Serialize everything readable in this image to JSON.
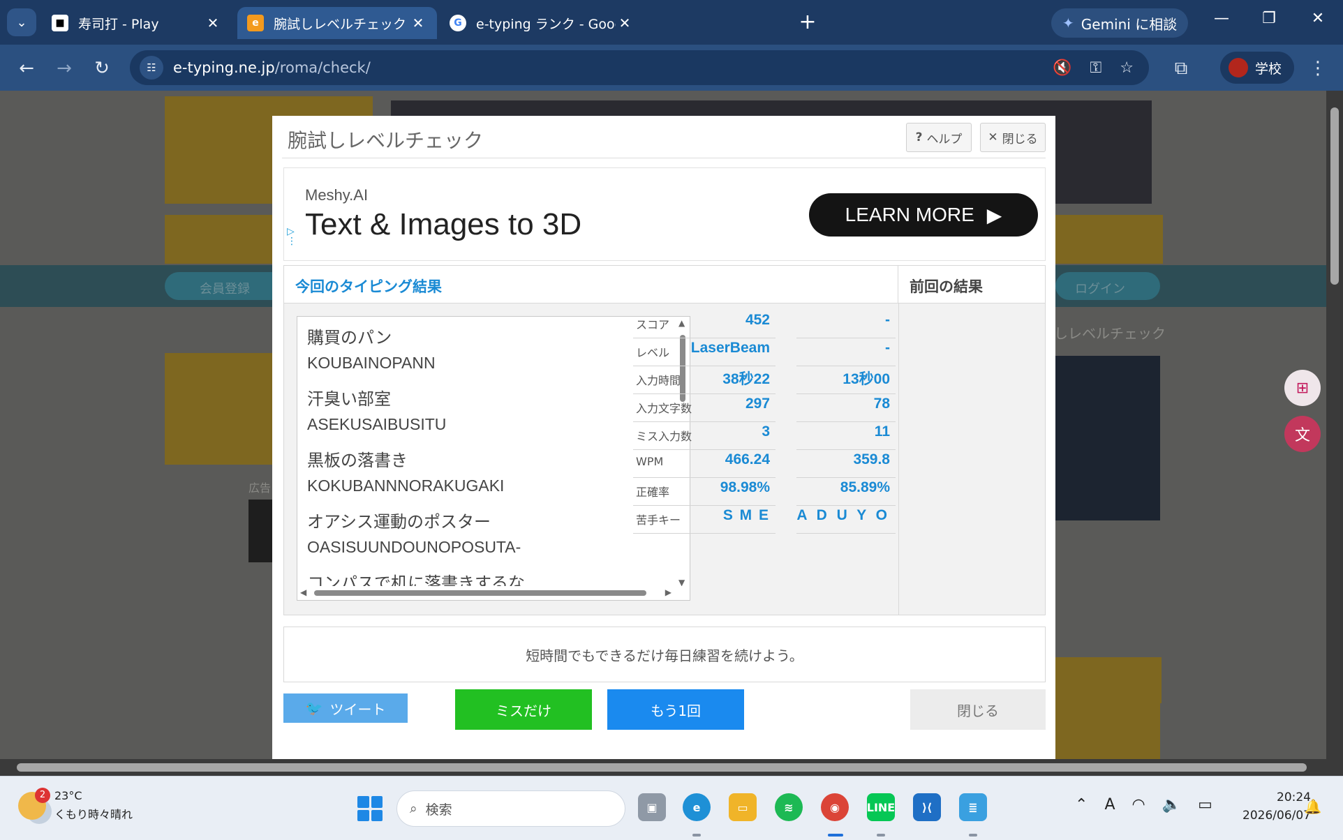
{
  "browser": {
    "tabs": [
      {
        "title": "寿司打 - Play",
        "active": false
      },
      {
        "title": "腕試しレベルチェック - インターネット",
        "active": true
      },
      {
        "title": "e-typing ランク - Google 検索",
        "active": false
      }
    ],
    "gemini_label": "Gemini に相談",
    "url_domain": "e-typing.ne.jp",
    "url_path": "/roma/check/",
    "profile_label": "学校"
  },
  "modal": {
    "title": "腕試しレベルチェック",
    "help_label": "ヘルプ",
    "close_top_label": "閉じる",
    "ad": {
      "brand": "Meshy.AI",
      "headline": "Text & Images to 3D",
      "cta": "LEARN MORE"
    },
    "results_header": "今回のタイピング結果",
    "previous_header": "前回の結果",
    "words": [
      {
        "jp": "購買のパン",
        "romaji": "KOUBAINOPANN"
      },
      {
        "jp": "汗臭い部室",
        "romaji": "ASEKUSAIBUSITU"
      },
      {
        "jp": "黒板の落書き",
        "romaji": "KOKUBANNNORAKUGAKI"
      },
      {
        "jp": "オアシス運動のポスター",
        "romaji": "OASISUUNDOUNOPOSUTA-"
      },
      {
        "jp": "コンパスで机に落書きするな",
        "romaji": ""
      }
    ],
    "stats": [
      {
        "label": "スコア",
        "current": "452",
        "previous": "-"
      },
      {
        "label": "レベル",
        "current": "LaserBeam",
        "previous": "-"
      },
      {
        "label": "入力時間",
        "current": "38秒22",
        "previous": "13秒00"
      },
      {
        "label": "入力文字数",
        "current": "297",
        "previous": "78"
      },
      {
        "label": "ミス入力数",
        "current": "3",
        "previous": "11"
      },
      {
        "label": "WPM",
        "current": "466.24",
        "previous": "359.8"
      },
      {
        "label": "正確率",
        "current": "98.98%",
        "previous": "85.89%"
      },
      {
        "label": "苦手キー",
        "current": "S M E",
        "previous": "A D U Y O"
      }
    ],
    "message": "短時間でもできるだけ毎日練習を続けよう。",
    "buttons": {
      "tweet": "ツイート",
      "miss_only": "ミスだけ",
      "retry": "もう1回",
      "close": "閉じる"
    }
  },
  "background_page": {
    "login": "ログイン",
    "member": "会員登録",
    "level_check": "しレベルチェック",
    "ad_label": "広告"
  },
  "taskbar": {
    "weather_badge": "2",
    "temperature": "23°C",
    "weather": "くもり時々晴れ",
    "search_placeholder": "検索",
    "time": "20:24",
    "date": "2026/06/07"
  }
}
